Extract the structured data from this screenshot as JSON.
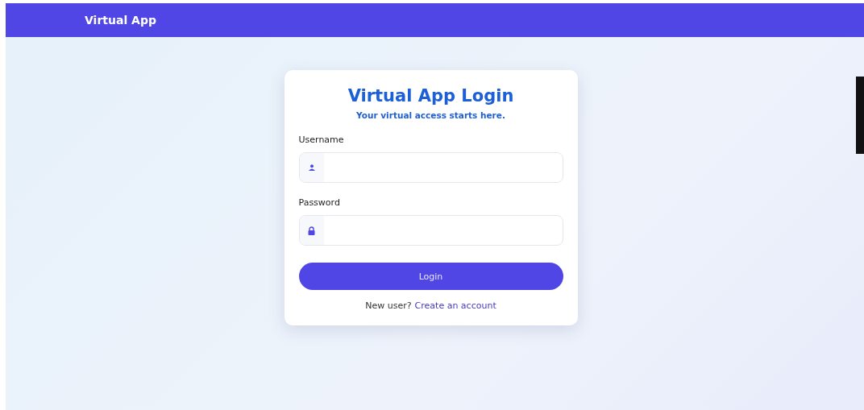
{
  "navbar": {
    "brand": "Virtual App"
  },
  "login": {
    "title": "Virtual App Login",
    "subtitle": "Your virtual access starts here.",
    "fields": [
      {
        "label": "Username",
        "kind": "user"
      },
      {
        "label": "Password",
        "kind": "password"
      }
    ],
    "button": "Login",
    "footer": {
      "text": "New user?",
      "link": "Create an account"
    }
  }
}
